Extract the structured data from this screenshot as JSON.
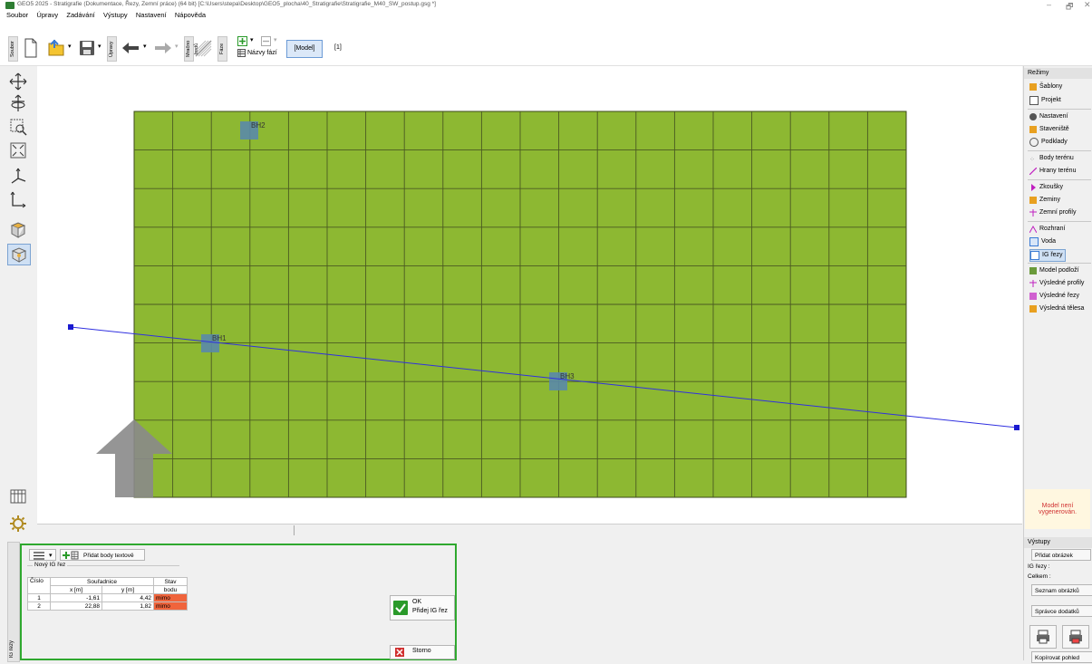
{
  "window": {
    "title": "GEO5 2025 - Stratigrafie (Dokumentace, Řezy, Zemní práce) (64 bit) [C:\\Users\\stepa\\Desktop\\GEO5_plocha\\40_Stratigrafie\\Stratigrafie_M40_SW_postup.gsg *]",
    "minimize": "–",
    "maximize": "🗗",
    "close": "✕"
  },
  "menu": [
    "Soubor",
    "Úpravy",
    "Zadávání",
    "Výstupy",
    "Nastavení",
    "Nápověda"
  ],
  "toolbar": {
    "tab_soubor": "Soubor",
    "tab_upravy": "Úpravy",
    "tab_mracno": "Mračno bodů",
    "tab_faze": "Fáze",
    "nazvy_fazi": "Názvy fází",
    "model_button": "[Model]",
    "phase_label": "[1]"
  },
  "canvas": {
    "boreholes": [
      "BH2",
      "BH1",
      "BH3"
    ],
    "grid_color": "#8db832",
    "line_color": "#3030e0"
  },
  "right_panel": {
    "header": "Režimy",
    "items": [
      {
        "label": "Šablony",
        "icon": "templates-icon"
      },
      {
        "label": "Projekt",
        "icon": "project-icon"
      },
      {
        "label": "Nastavení",
        "icon": "gear-icon"
      },
      {
        "label": "Staveniště",
        "icon": "site-icon"
      },
      {
        "label": "Podklady",
        "icon": "background-icon"
      },
      {
        "label": "Body terénu",
        "icon": "terrain-points-icon"
      },
      {
        "label": "Hrany terénu",
        "icon": "terrain-edges-icon"
      },
      {
        "label": "Zkoušky",
        "icon": "tests-icon"
      },
      {
        "label": "Zeminy",
        "icon": "soils-icon"
      },
      {
        "label": "Zemní profily",
        "icon": "soil-profiles-icon"
      },
      {
        "label": "Rozhraní",
        "icon": "interfaces-icon"
      },
      {
        "label": "Voda",
        "icon": "water-icon"
      },
      {
        "label": "IG řezy",
        "icon": "ig-sections-icon"
      },
      {
        "label": "Model podloží",
        "icon": "subsoil-model-icon"
      },
      {
        "label": "Výsledné profily",
        "icon": "result-profiles-icon"
      },
      {
        "label": "Výsledné řezy",
        "icon": "result-sections-icon"
      },
      {
        "label": "Výsledná tělesa",
        "icon": "result-bodies-icon"
      }
    ],
    "warning": "Model není vygenerován."
  },
  "outputs": {
    "header": "Výstupy",
    "add_image": "Přidat obrázek",
    "ig_rezy": "IG řezy :",
    "celkem": "Celkem :",
    "image_list": "Seznam obrázků",
    "attachments": "Správce dodatků",
    "copy_view": "Kopírovat pohled"
  },
  "bottom": {
    "side_tab": "IG řezy",
    "add_text_points": "Přidat body textově",
    "group_title": "Nový IG řez",
    "table": {
      "col_cislo": "Číslo",
      "col_souradnice": "Souřadnice",
      "col_x": "x [m]",
      "col_y": "y [m]",
      "col_stav": "Stav",
      "col_bodu": "bodu",
      "rows": [
        {
          "n": "1",
          "x": "-1,61",
          "y": "4,42",
          "stav": "mimo"
        },
        {
          "n": "2",
          "x": "22,88",
          "y": "1,82",
          "stav": "mimo"
        }
      ]
    },
    "ok_label": "OK",
    "ok_sub": "Přidej IG řez",
    "storno": "Storno"
  }
}
